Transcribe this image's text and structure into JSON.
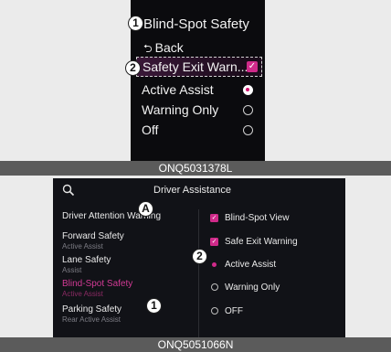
{
  "top_figure": {
    "title": "Blind-Spot Safety",
    "back_label": "Back",
    "selected_item": "Safety Exit Warn...",
    "options": [
      "Active Assist",
      "Warning Only",
      "Off"
    ],
    "markers": [
      "1",
      "2"
    ],
    "caption": "ONQ5031378L"
  },
  "bottom_figure": {
    "title": "Driver Assistance",
    "marker_a": "A",
    "left_menu": [
      {
        "label": "Driver Attention Warning",
        "sub": ""
      },
      {
        "label": "Forward Safety",
        "sub": "Active Assist"
      },
      {
        "label": "Lane Safety",
        "sub": "Assist"
      },
      {
        "label": "Blind-Spot Safety",
        "sub": "Active Assist"
      },
      {
        "label": "Parking Safety",
        "sub": "Rear Active Assist"
      }
    ],
    "right_options": [
      {
        "label": "Blind-Spot View",
        "state": "checked"
      },
      {
        "label": "Safe Exit Warning",
        "state": "checked"
      },
      {
        "label": "Active Assist",
        "state": "selected"
      },
      {
        "label": "Warning Only",
        "state": "unselected"
      },
      {
        "label": "OFF",
        "state": "unselected"
      }
    ],
    "markers": [
      "1",
      "2"
    ],
    "caption": "ONQ5051066N"
  },
  "colors": {
    "accent": "#d02a8a",
    "screen_bg": "#0b0b0e",
    "caption_bg": "#5b5b5b"
  }
}
